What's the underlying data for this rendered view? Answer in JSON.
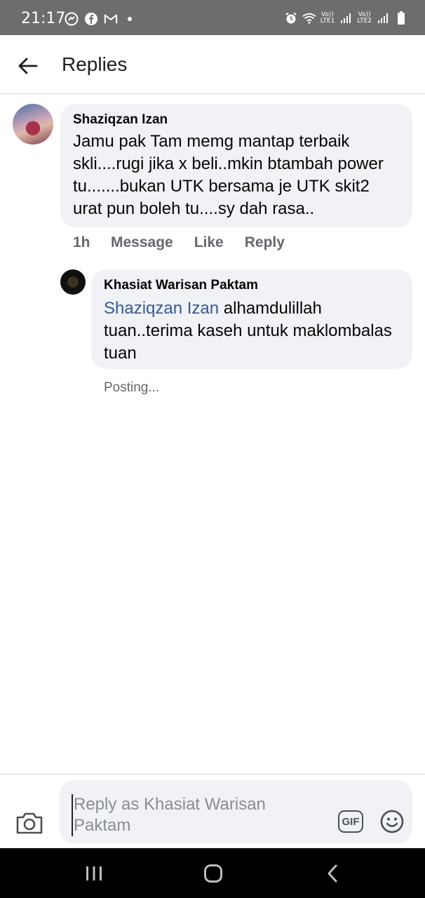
{
  "status_bar": {
    "time": "21:17",
    "left_icons": [
      "messenger-icon",
      "facebook-icon",
      "gmail-icon",
      "notification-dot"
    ],
    "right_icons": [
      "alarm-icon",
      "wifi-icon",
      "signal-icon",
      "signal-icon",
      "battery-icon"
    ],
    "sim1_top": "Vo))",
    "sim1_bottom": "LTE1",
    "sim2_top": "Vo))",
    "sim2_bottom": "LTE2"
  },
  "header": {
    "title": "Replies"
  },
  "comment": {
    "author": "Shaziqzan Izan",
    "text": "Jamu pak Tam memg mantap terbaik skli....rugi jika x beli..mkin btambah power tu.......bukan UTK bersama je UTK skit2 urat pun boleh tu....sy dah rasa..",
    "time": "1h",
    "actions": {
      "message": "Message",
      "like": "Like",
      "reply": "Reply"
    }
  },
  "reply": {
    "author": "Khasiat Warisan Paktam",
    "mention": "Shaziqzan Izan",
    "text": " alhamdulillah tuan..terima kaseh untuk maklombalas tuan",
    "status": "Posting..."
  },
  "composer": {
    "placeholder": "Reply as Khasiat Warisan Paktam",
    "gif_label": "GIF"
  },
  "colors": {
    "bubble": "#f0f2f5",
    "mention": "#385898",
    "secondary_text": "#65676b",
    "status_bar": "#6d6d6d"
  }
}
